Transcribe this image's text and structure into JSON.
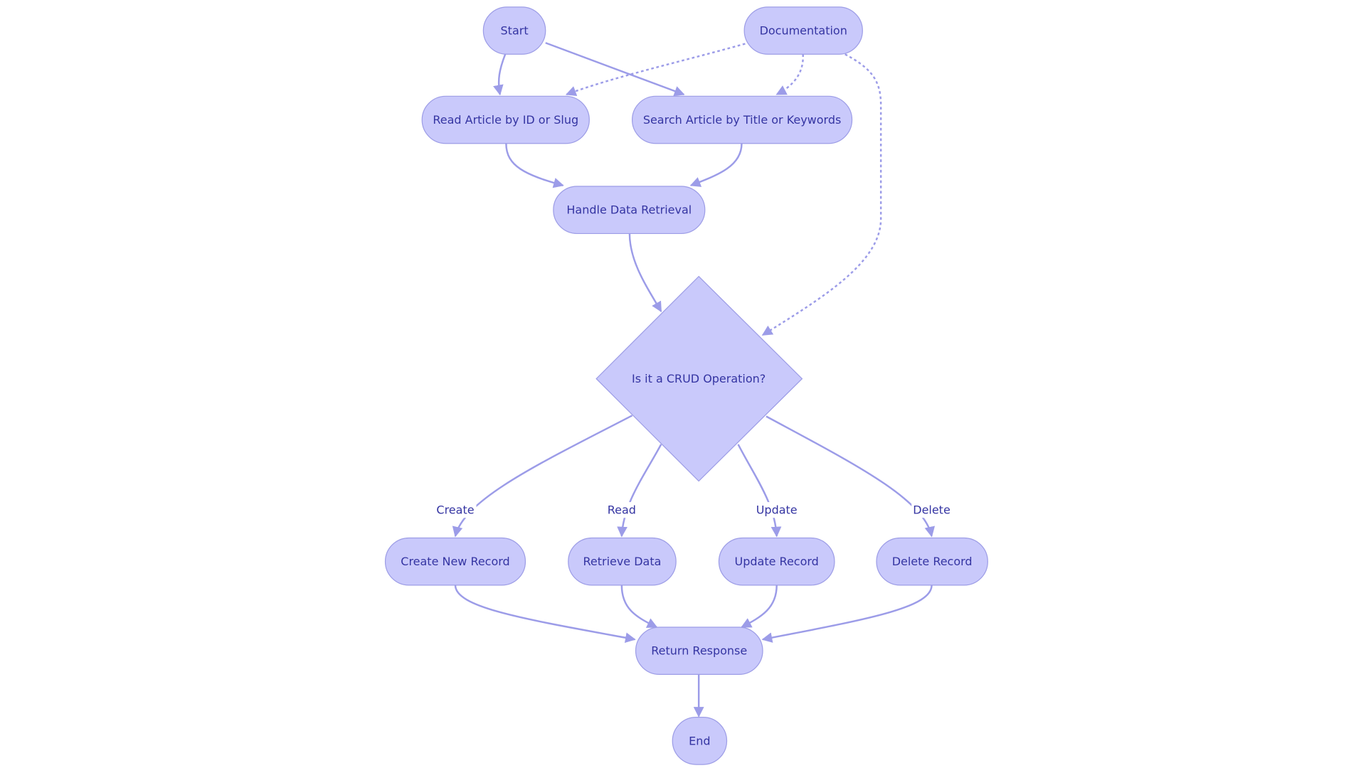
{
  "diagram": {
    "type": "flowchart",
    "colors": {
      "node_fill": "#c9c9fb",
      "node_stroke": "#9d9de6",
      "edge": "#9c9ce8",
      "text": "#3434a2",
      "background": "#ffffff"
    },
    "nodes": [
      {
        "id": "start",
        "label": "Start",
        "shape": "rounded"
      },
      {
        "id": "documentation",
        "label": "Documentation",
        "shape": "rounded"
      },
      {
        "id": "read_article",
        "label": "Read Article by ID or Slug",
        "shape": "rounded"
      },
      {
        "id": "search_article",
        "label": "Search Article by Title or Keywords",
        "shape": "rounded"
      },
      {
        "id": "handle_retrieval",
        "label": "Handle Data Retrieval",
        "shape": "rounded"
      },
      {
        "id": "crud_decision",
        "label": "Is it a CRUD Operation?",
        "shape": "diamond"
      },
      {
        "id": "create_record",
        "label": "Create New Record",
        "shape": "rounded"
      },
      {
        "id": "retrieve_data",
        "label": "Retrieve Data",
        "shape": "rounded"
      },
      {
        "id": "update_record",
        "label": "Update Record",
        "shape": "rounded"
      },
      {
        "id": "delete_record",
        "label": "Delete Record",
        "shape": "rounded"
      },
      {
        "id": "return_response",
        "label": "Return Response",
        "shape": "rounded"
      },
      {
        "id": "end",
        "label": "End",
        "shape": "rounded"
      }
    ],
    "edges": [
      {
        "from": "start",
        "to": "read_article",
        "style": "solid",
        "label": ""
      },
      {
        "from": "start",
        "to": "search_article",
        "style": "solid",
        "label": ""
      },
      {
        "from": "documentation",
        "to": "read_article",
        "style": "dotted",
        "label": ""
      },
      {
        "from": "documentation",
        "to": "search_article",
        "style": "dotted",
        "label": ""
      },
      {
        "from": "documentation",
        "to": "crud_decision",
        "style": "dotted",
        "label": ""
      },
      {
        "from": "read_article",
        "to": "handle_retrieval",
        "style": "solid",
        "label": ""
      },
      {
        "from": "search_article",
        "to": "handle_retrieval",
        "style": "solid",
        "label": ""
      },
      {
        "from": "handle_retrieval",
        "to": "crud_decision",
        "style": "solid",
        "label": ""
      },
      {
        "from": "crud_decision",
        "to": "create_record",
        "style": "solid",
        "label": "Create"
      },
      {
        "from": "crud_decision",
        "to": "retrieve_data",
        "style": "solid",
        "label": "Read"
      },
      {
        "from": "crud_decision",
        "to": "update_record",
        "style": "solid",
        "label": "Update"
      },
      {
        "from": "crud_decision",
        "to": "delete_record",
        "style": "solid",
        "label": "Delete"
      },
      {
        "from": "create_record",
        "to": "return_response",
        "style": "solid",
        "label": ""
      },
      {
        "from": "retrieve_data",
        "to": "return_response",
        "style": "solid",
        "label": ""
      },
      {
        "from": "update_record",
        "to": "return_response",
        "style": "solid",
        "label": ""
      },
      {
        "from": "delete_record",
        "to": "return_response",
        "style": "solid",
        "label": ""
      },
      {
        "from": "return_response",
        "to": "end",
        "style": "solid",
        "label": ""
      }
    ]
  }
}
